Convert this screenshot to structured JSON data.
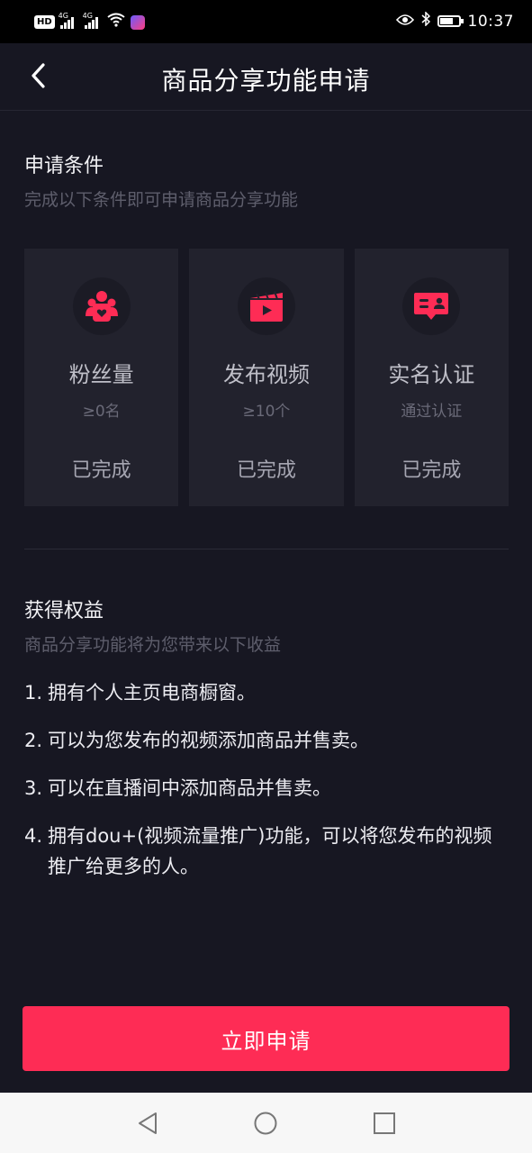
{
  "status_bar": {
    "hd": "HD",
    "net1": "4G",
    "net2": "4G",
    "time": "10:37"
  },
  "header": {
    "title": "商品分享功能申请"
  },
  "conditions": {
    "title": "申请条件",
    "subtitle": "完成以下条件即可申请商品分享功能",
    "cards": [
      {
        "label": "粉丝量",
        "requirement": "≥0名",
        "status": "已完成",
        "icon": "fans-icon"
      },
      {
        "label": "发布视频",
        "requirement": "≥10个",
        "status": "已完成",
        "icon": "video-clapper-icon"
      },
      {
        "label": "实名认证",
        "requirement": "通过认证",
        "status": "已完成",
        "icon": "id-card-icon"
      }
    ]
  },
  "benefits": {
    "title": "获得权益",
    "subtitle": "商品分享功能将为您带来以下收益",
    "items": [
      {
        "num": "1.",
        "text": "拥有个人主页电商橱窗。"
      },
      {
        "num": "2.",
        "text": "可以为您发布的视频添加商品并售卖。"
      },
      {
        "num": "3.",
        "text": "可以在直播间中添加商品并售卖。"
      },
      {
        "num": "4.",
        "text": "拥有dou+(视频流量推广)功能，可以将您发布的视频推广给更多的人。"
      }
    ]
  },
  "apply_button": {
    "label": "立即申请"
  },
  "colors": {
    "accent": "#fe2c55",
    "background": "#171722",
    "card": "#22222d"
  }
}
